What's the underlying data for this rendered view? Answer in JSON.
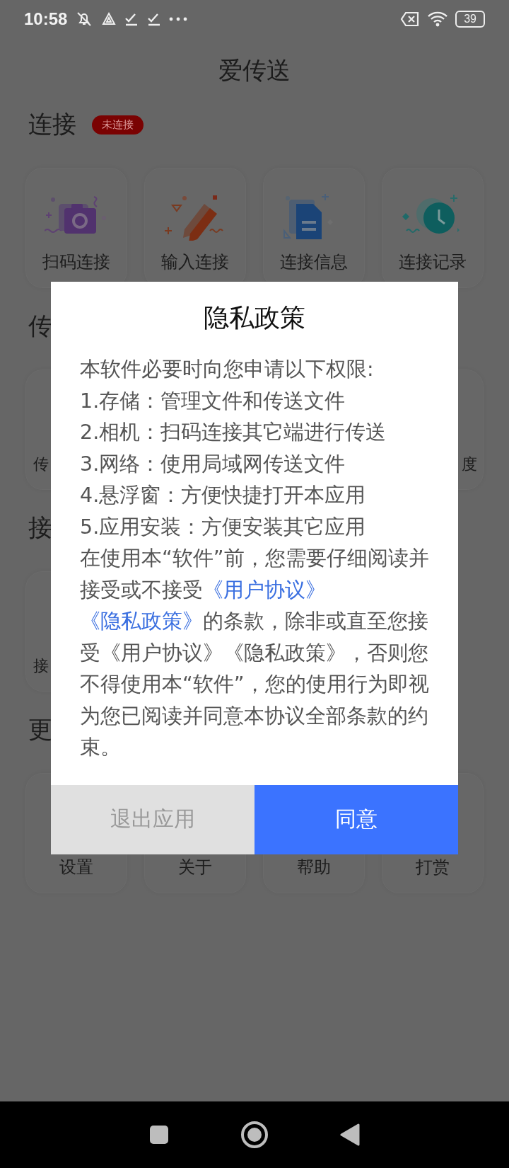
{
  "status_bar": {
    "time": "10:58",
    "battery": "39"
  },
  "app_title": "爱传送",
  "sections": [
    {
      "title": "连接",
      "badge": "未连接",
      "cards": [
        {
          "label": "扫码连接"
        },
        {
          "label": "输入连接"
        },
        {
          "label": "连接信息"
        },
        {
          "label": "连接记录"
        }
      ]
    },
    {
      "title": "传",
      "cards": [
        {
          "label": "传"
        },
        {
          "label": "度"
        }
      ]
    },
    {
      "title": "接",
      "cards": [
        {
          "label": "接"
        }
      ]
    },
    {
      "title": "更",
      "cards": [
        {
          "label": "设置"
        },
        {
          "label": "关于"
        },
        {
          "label": "帮助"
        },
        {
          "label": "打赏"
        }
      ]
    }
  ],
  "dialog": {
    "title": "隐私政策",
    "intro": "本软件必要时向您申请以下权限:",
    "permissions": [
      "1.存储：管理文件和传送文件",
      "2.相机：扫码连接其它端进行传送",
      "3.网络：使用局域网传送文件",
      "4.悬浮窗：方便快捷打开本应用",
      "5.应用安装：方便安装其它应用"
    ],
    "agreement": [
      {
        "kind": "text",
        "text": "在使用本“软件”前，您需要仔细阅读并接受或不接受"
      },
      {
        "kind": "link",
        "text": "《用户协议》"
      },
      {
        "kind": "link",
        "text": "《隐私政策》"
      },
      {
        "kind": "text",
        "text": "的条款，除非或直至您接受《用户协议》《隐私政策》，否则您不得使用本“软件”，您的使用行为即视为您已阅读并同意本协议全部条款的约束。"
      }
    ],
    "buttons": [
      {
        "label": "退出应用",
        "primary": false
      },
      {
        "label": "同意",
        "primary": true
      }
    ]
  }
}
